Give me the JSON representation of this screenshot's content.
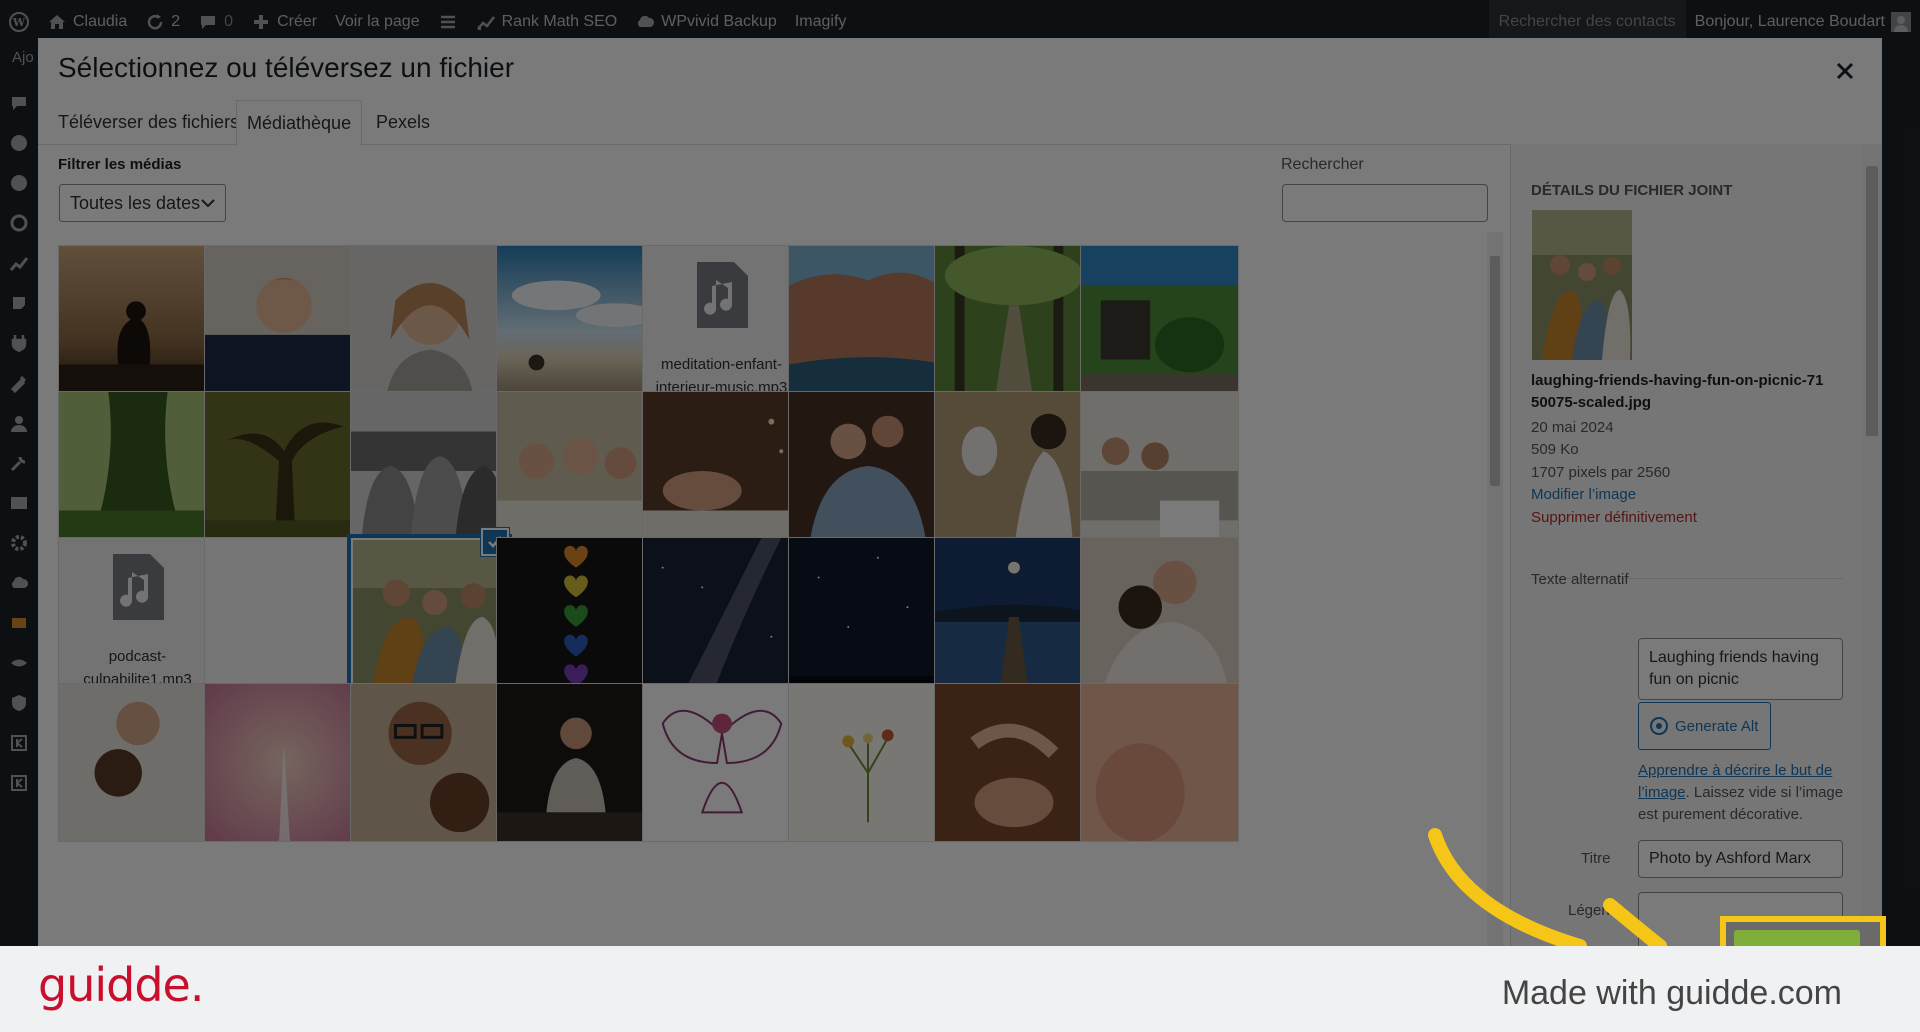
{
  "admin_bar": {
    "site_name": "Claudia",
    "updates_count": "2",
    "comments_count": "0",
    "new_label": "Créer",
    "view_page": "Voir la page",
    "rank_math": "Rank Math SEO",
    "wpvivid": "WPvivid Backup",
    "imagify": "Imagify",
    "search_contacts": "Rechercher des contacts",
    "greeting": "Bonjour, Laurence Boudart"
  },
  "admin_menu": {
    "top_label": "Ajo"
  },
  "modal": {
    "title": "Sélectionnez ou téléversez un fichier",
    "tabs": [
      {
        "label": "Téléverser des fichiers"
      },
      {
        "label": "Médiathèque"
      },
      {
        "label": "Pexels"
      }
    ],
    "filter_label": "Filtrer les médias",
    "date_filter_value": "Toutes les dates",
    "search_label": "Rechercher"
  },
  "media_grid": {
    "audio_files": [
      {
        "name": "meditation-enfant-interieur-music.mp3"
      },
      {
        "name": "podcast-culpabilite1.mp3"
      }
    ]
  },
  "attachment_details": {
    "heading": "Détails du fichier joint",
    "filename": "laughing-friends-having-fun-on-picnic-7150075-scaled.jpg",
    "date": "20 mai 2024",
    "size": "509 Ko",
    "dimensions": "1707 pixels par 2560",
    "edit_link": "Modifier l’image",
    "delete_link": "Supprimer définitivement",
    "alt_label": "Texte alternatif",
    "alt_value": "Laughing friends having fun on picnic",
    "generate_alt": "Generate Alt",
    "alt_help_link": "Apprendre à décrire le but de l’image",
    "alt_help_text": ". Laissez vide si l’image est purement décorative.",
    "title_label": "Titre",
    "title_value": "Photo by Ashford Marx",
    "caption_label": "Légende"
  },
  "footer": {
    "brand": "guidde.",
    "made_with": "Made with guidde.com"
  },
  "colors": {
    "accent": "#2271b1",
    "highlight": "#f5c518",
    "brand": "#c8102e"
  }
}
